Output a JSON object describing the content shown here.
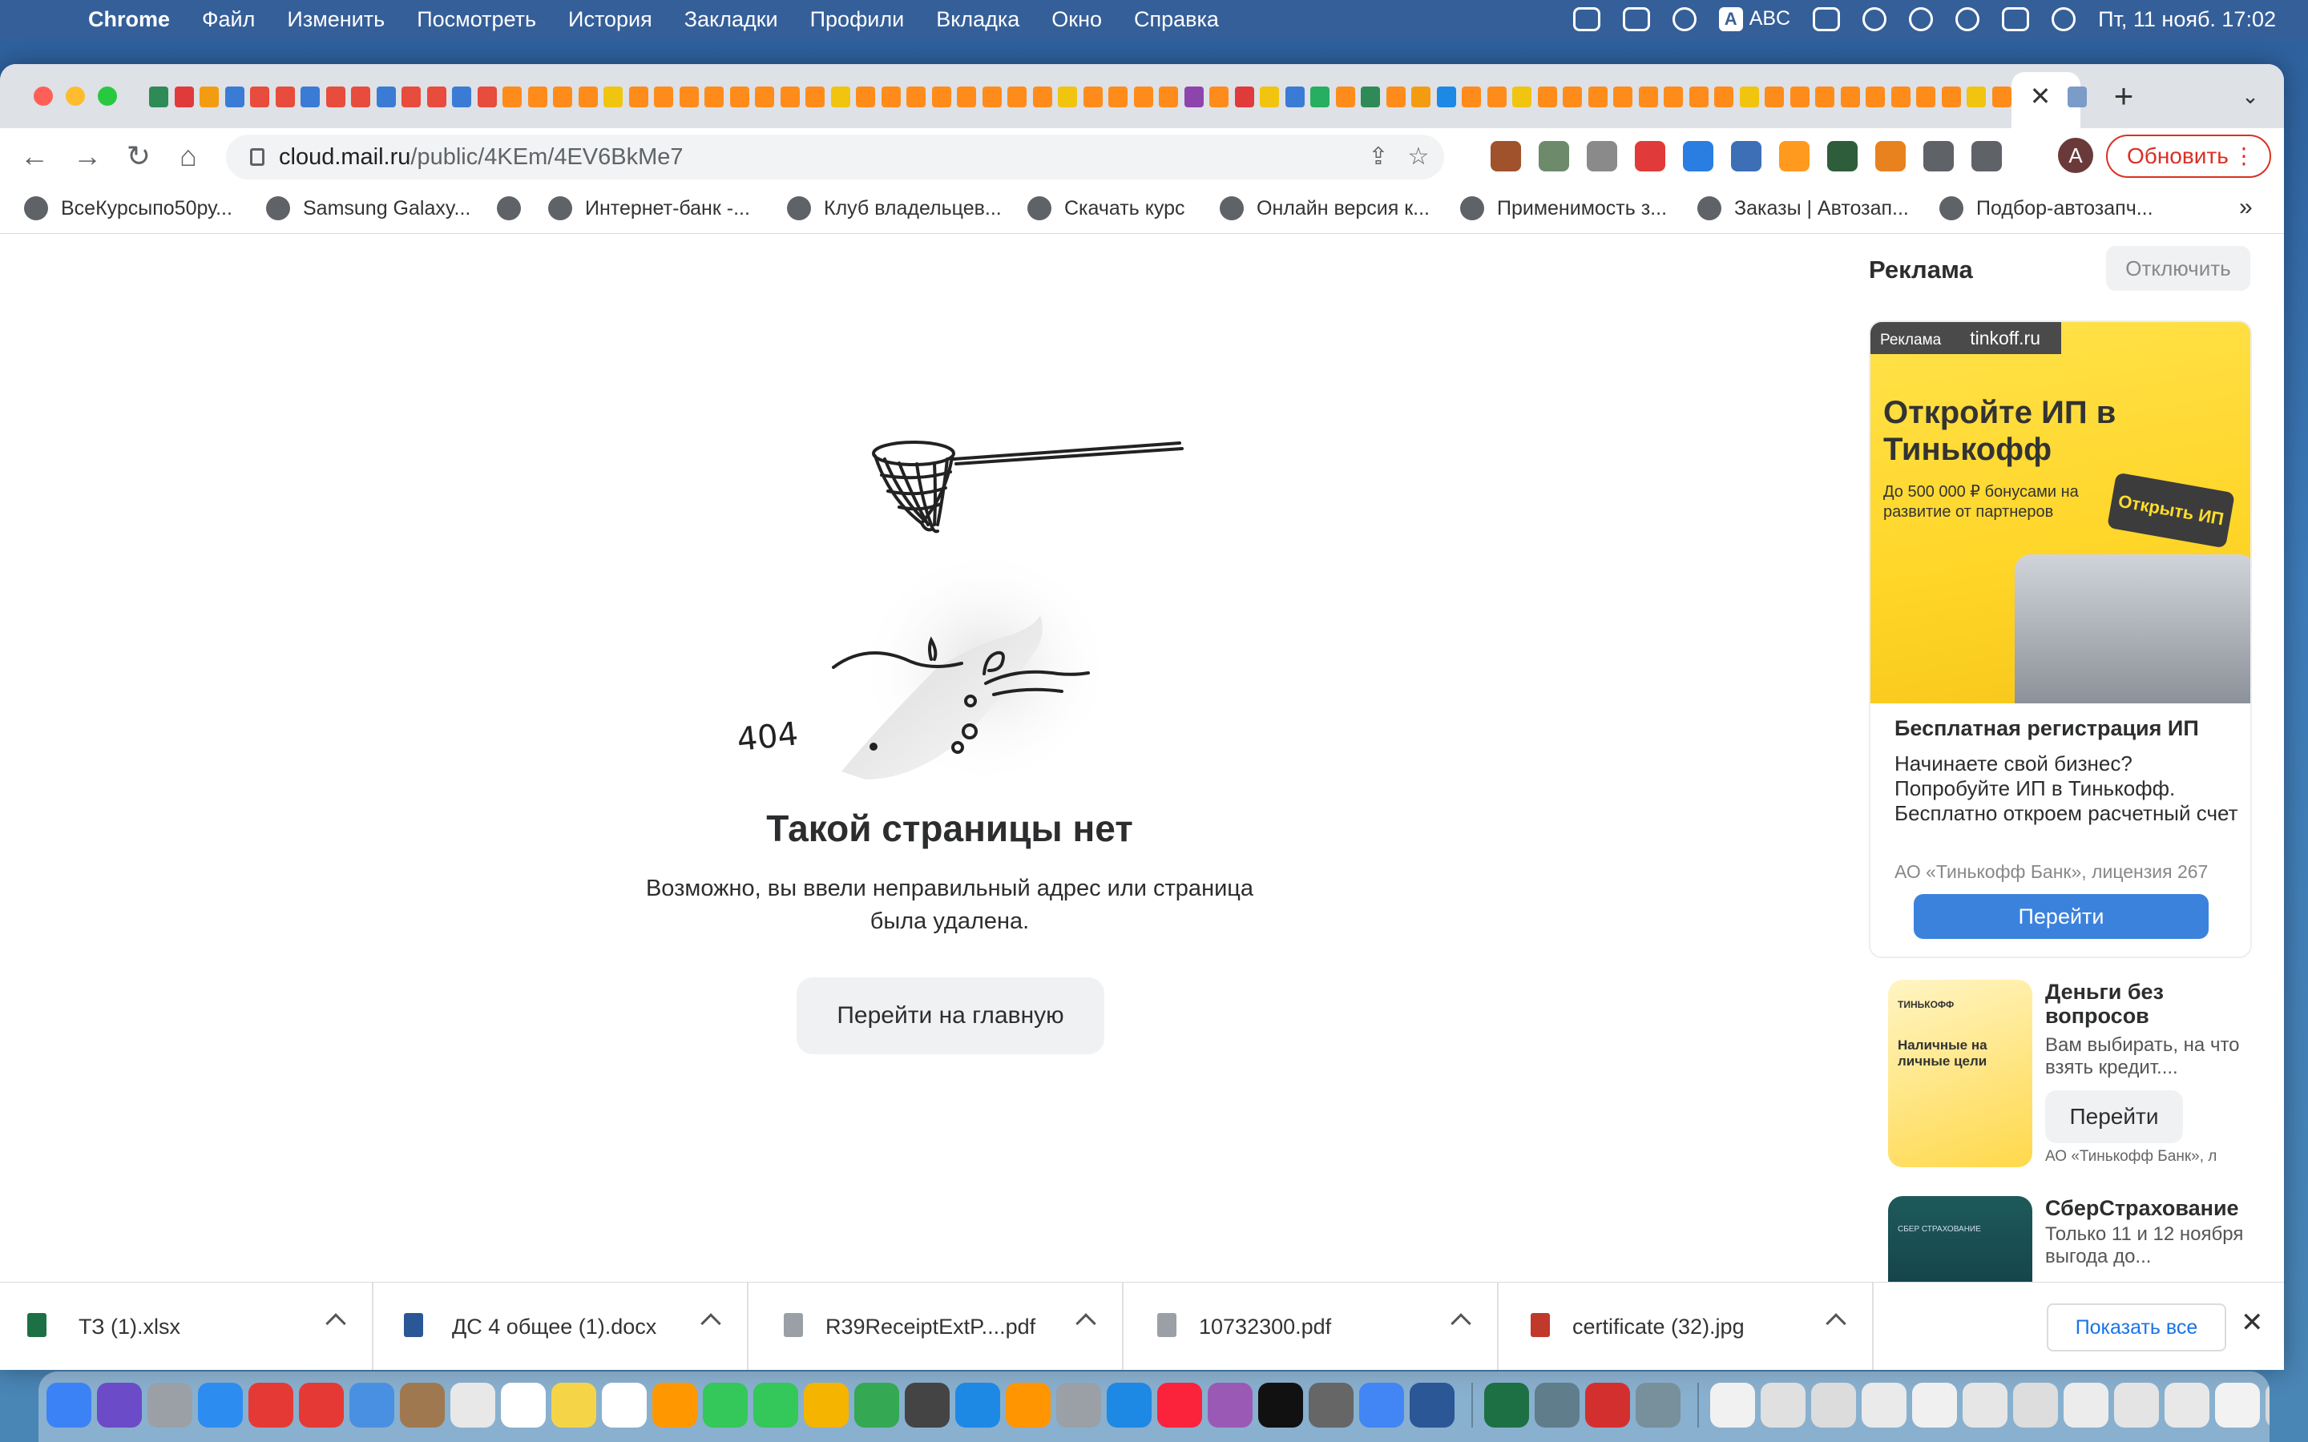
{
  "menubar": {
    "app": "Chrome",
    "items": [
      "Файл",
      "Изменить",
      "Посмотреть",
      "История",
      "Закладки",
      "Профили",
      "Вкладка",
      "Окно",
      "Справка"
    ],
    "input_source": "ABC",
    "input_badge": "A",
    "clock": "Пт, 11 нояб. 17:02"
  },
  "tabs": {
    "close_glyph": "✕",
    "new_tab_glyph": "+",
    "tab_list_glyph": "⌄"
  },
  "toolbar": {
    "url_host": "cloud.mail.ru",
    "url_path": "/public/4KEm/4EV6BkMe7",
    "avatar_letter": "A",
    "update_label": "Обновить"
  },
  "bookmarks": [
    {
      "label": "ВсеКурсыпо50ру...",
      "color": "#c62828"
    },
    {
      "label": "Samsung Galaxy...",
      "color": "#5f6368"
    },
    {
      "label": "",
      "color": "#5f6368"
    },
    {
      "label": "Интернет-банк -...",
      "color": "#444444"
    },
    {
      "label": "Клуб владельцев...",
      "color": "#d32f2f"
    },
    {
      "label": "Скачать курс",
      "color": "#5f6368"
    },
    {
      "label": "Онлайн версия к...",
      "color": "#5f6368"
    },
    {
      "label": "Применимость з...",
      "color": "#d9534f"
    },
    {
      "label": "Заказы | Автозап...",
      "color": "#1f4e9e"
    },
    {
      "label": "Подбор-автозапч...",
      "color": "#d9534f"
    }
  ],
  "bookmarks_more": "»",
  "error": {
    "code": "404",
    "title": "Такой страницы нет",
    "subtitle": "Возможно, вы ввели неправильный адрес или страница была удалена.",
    "home_button": "Перейти на главную"
  },
  "ads": {
    "title": "Реклама",
    "disable_button": "Отключить",
    "main": {
      "tag": "Реклама",
      "domain": "tinkoff.ru",
      "image_headline": "Откройте ИП в Тинькофф",
      "image_small": "До 500 000 ₽ бонусами на развитие от партнеров",
      "image_button": "Открыть ИП",
      "headline": "Бесплатная регистрация ИП",
      "text": "Начинаете свой бизнес? Попробуйте ИП в Тинькофф. Бесплатно откроем расчетный счет",
      "meta": "АО «Тинькофф Банк», лицензия 267",
      "cta": "Перейти"
    },
    "second": {
      "image_logo": "ТИНЬКОФФ",
      "image_label": "Наличные на личные цели",
      "headline": "Деньги без вопросов",
      "text": "Вам выбирать, на что взять кредит....",
      "cta": "Перейти",
      "meta": "АО «Тинькофф Банк», л"
    },
    "third": {
      "image_label": "СБЕР СТРАХОВАНИЕ",
      "headline": "СберСтрахование",
      "text": "Только 11 и 12 ноября выгода до..."
    }
  },
  "downloads": {
    "items": [
      {
        "name": "ТЗ  (1).xlsx",
        "color": "#1d7044"
      },
      {
        "name": "ДС 4 общее (1).docx",
        "color": "#2b5797"
      },
      {
        "name": "R39ReceiptExtP....pdf",
        "color": "#9aa0a6"
      },
      {
        "name": "10732300.pdf",
        "color": "#9aa0a6"
      },
      {
        "name": "certificate (32).jpg",
        "color": "#c0392b"
      }
    ],
    "show_all": "Показать все",
    "close_glyph": "✕"
  },
  "colors": {
    "update_red": "#d93025",
    "ad_blue": "#3b82dd",
    "tinkoff_yellow": "#ffdd2d"
  }
}
